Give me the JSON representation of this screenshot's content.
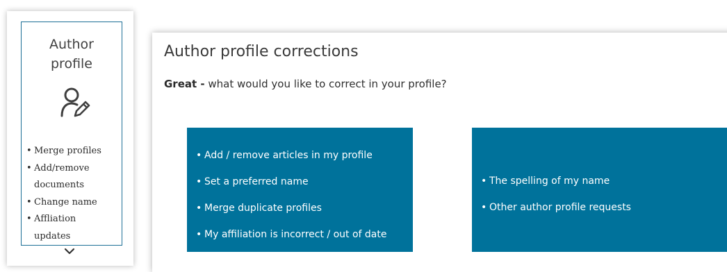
{
  "sidebar": {
    "title_line1": "Author",
    "title_line2": "profile",
    "icon": "user-edit-icon",
    "items": [
      {
        "label": "Merge profiles"
      },
      {
        "label": "Add/remove"
      },
      {
        "label": "documents"
      },
      {
        "label": "Change name"
      },
      {
        "label": "Affliation"
      },
      {
        "label": "updates"
      }
    ],
    "expand_icon": "chevron-down-icon",
    "accent_color": "#1c6f96"
  },
  "main": {
    "title": "Author profile corrections",
    "subtitle_bold": "Great -",
    "subtitle_rest": " what would you like to correct in your profile?",
    "option_color": "#00729b",
    "options_left": [
      "Add / remove articles in my profile",
      "Set a preferred name",
      "Merge duplicate profiles",
      "My affiliation is incorrect / out of date"
    ],
    "options_right": [
      "The spelling of my name",
      "Other author profile requests"
    ]
  }
}
